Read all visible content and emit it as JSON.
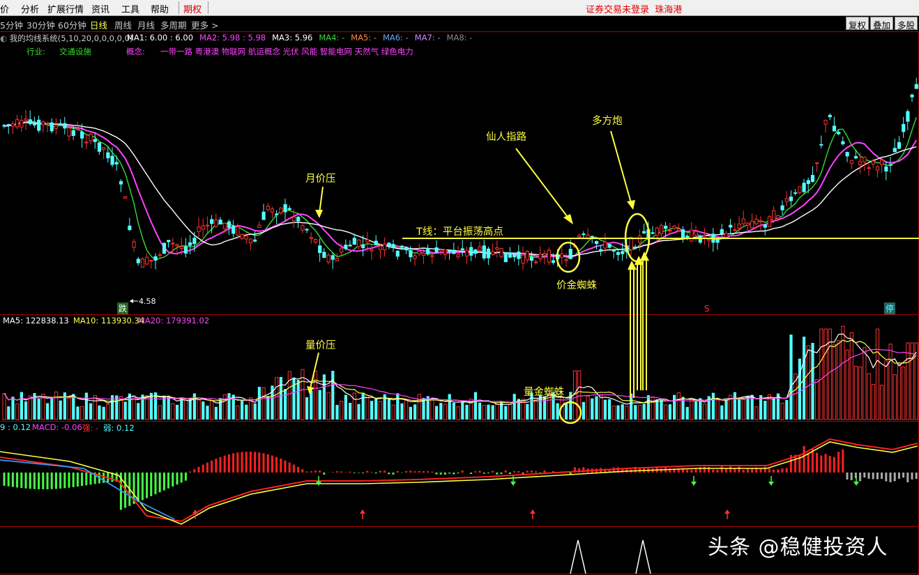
{
  "menu": {
    "items": [
      "价",
      "分析",
      "扩展行情",
      "资讯",
      "工具",
      "帮助"
    ],
    "qiquan": "期权",
    "status": "证券交易未登录",
    "broker": "珠海港"
  },
  "periods": {
    "items": [
      "5分钟",
      "30分钟",
      "60分钟",
      "日线",
      "周线",
      "月线",
      "多周期",
      "更多 >"
    ],
    "active": "日线",
    "right_buttons": [
      "复权",
      "叠加",
      "多股"
    ]
  },
  "main_panel": {
    "system": "我的均线系统(5,10,20,0,0,0,0,0)",
    "ma_items": [
      {
        "label": "MA1: 6.00 : 6.00",
        "color": "#ffffff"
      },
      {
        "label": "MA2: 5.98 : 5.98",
        "color": "#ff44ff"
      },
      {
        "label": "MA3: 5.96",
        "color": "#ffffff"
      },
      {
        "label": "MA4: -",
        "color": "#33dd33"
      },
      {
        "label": "MA5: -",
        "color": "#ff8844"
      },
      {
        "label": "MA6: -",
        "color": "#66aaff"
      },
      {
        "label": "MA7: -",
        "color": "#cc88ff"
      },
      {
        "label": "MA8: -",
        "color": "#888888"
      }
    ],
    "industry_label": "行业:",
    "industry": "交通设施",
    "concept_label": "概念:",
    "concepts": "一带一路 粤港澳 物联网 航运概念 光伏 风能 智能电网 天然气 绿色电力",
    "low_mark": "4.58",
    "marker_die": "跌",
    "marker_s": "S",
    "marker_ting": "停"
  },
  "volume_panel": {
    "ma5": "MA5: 122838.13",
    "ma10": "MA10: 113930.34",
    "ma20": "MA20: 179391.02"
  },
  "macd_panel": {
    "dif": "9 : 0.12",
    "macd": "MACD: -0.06",
    "strong": "强: -",
    "weak": "弱: 0.12"
  },
  "annotations": {
    "yue_jia_ya": "月价压",
    "xian_ren_zhi_lu": "仙人指路",
    "duo_fang_pao": "多方炮",
    "t_line": "T线：平台振荡高点",
    "jia_jin_zhi_zhu": "价金蜘蛛",
    "liang_jia_ya": "量价压",
    "liang_jin_zhi_zhu": "量金蜘蛛"
  },
  "watermark": "头条 @稳健投资人",
  "colors": {
    "up": "#ff3232",
    "down": "#54ffff",
    "ma5": "#ffffff",
    "ma10": "#ff44ff",
    "ma20": "#33dd33",
    "annotation": "#ffff40",
    "panel_border": "#b00000"
  }
}
